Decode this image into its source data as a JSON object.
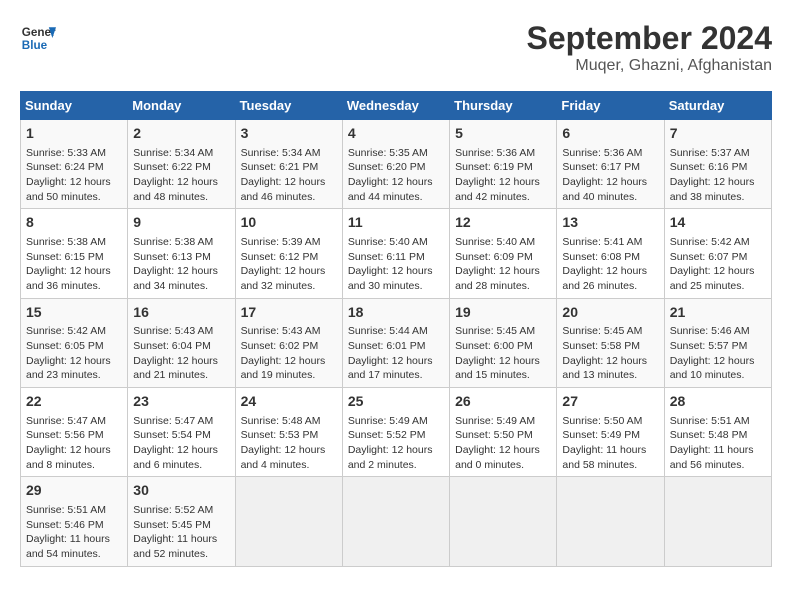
{
  "header": {
    "logo_line1": "General",
    "logo_line2": "Blue",
    "title": "September 2024",
    "subtitle": "Muqer, Ghazni, Afghanistan"
  },
  "columns": [
    "Sunday",
    "Monday",
    "Tuesday",
    "Wednesday",
    "Thursday",
    "Friday",
    "Saturday"
  ],
  "weeks": [
    [
      {
        "day": "1",
        "lines": [
          "Sunrise: 5:33 AM",
          "Sunset: 6:24 PM",
          "Daylight: 12 hours",
          "and 50 minutes."
        ]
      },
      {
        "day": "2",
        "lines": [
          "Sunrise: 5:34 AM",
          "Sunset: 6:22 PM",
          "Daylight: 12 hours",
          "and 48 minutes."
        ]
      },
      {
        "day": "3",
        "lines": [
          "Sunrise: 5:34 AM",
          "Sunset: 6:21 PM",
          "Daylight: 12 hours",
          "and 46 minutes."
        ]
      },
      {
        "day": "4",
        "lines": [
          "Sunrise: 5:35 AM",
          "Sunset: 6:20 PM",
          "Daylight: 12 hours",
          "and 44 minutes."
        ]
      },
      {
        "day": "5",
        "lines": [
          "Sunrise: 5:36 AM",
          "Sunset: 6:19 PM",
          "Daylight: 12 hours",
          "and 42 minutes."
        ]
      },
      {
        "day": "6",
        "lines": [
          "Sunrise: 5:36 AM",
          "Sunset: 6:17 PM",
          "Daylight: 12 hours",
          "and 40 minutes."
        ]
      },
      {
        "day": "7",
        "lines": [
          "Sunrise: 5:37 AM",
          "Sunset: 6:16 PM",
          "Daylight: 12 hours",
          "and 38 minutes."
        ]
      }
    ],
    [
      {
        "day": "8",
        "lines": [
          "Sunrise: 5:38 AM",
          "Sunset: 6:15 PM",
          "Daylight: 12 hours",
          "and 36 minutes."
        ]
      },
      {
        "day": "9",
        "lines": [
          "Sunrise: 5:38 AM",
          "Sunset: 6:13 PM",
          "Daylight: 12 hours",
          "and 34 minutes."
        ]
      },
      {
        "day": "10",
        "lines": [
          "Sunrise: 5:39 AM",
          "Sunset: 6:12 PM",
          "Daylight: 12 hours",
          "and 32 minutes."
        ]
      },
      {
        "day": "11",
        "lines": [
          "Sunrise: 5:40 AM",
          "Sunset: 6:11 PM",
          "Daylight: 12 hours",
          "and 30 minutes."
        ]
      },
      {
        "day": "12",
        "lines": [
          "Sunrise: 5:40 AM",
          "Sunset: 6:09 PM",
          "Daylight: 12 hours",
          "and 28 minutes."
        ]
      },
      {
        "day": "13",
        "lines": [
          "Sunrise: 5:41 AM",
          "Sunset: 6:08 PM",
          "Daylight: 12 hours",
          "and 26 minutes."
        ]
      },
      {
        "day": "14",
        "lines": [
          "Sunrise: 5:42 AM",
          "Sunset: 6:07 PM",
          "Daylight: 12 hours",
          "and 25 minutes."
        ]
      }
    ],
    [
      {
        "day": "15",
        "lines": [
          "Sunrise: 5:42 AM",
          "Sunset: 6:05 PM",
          "Daylight: 12 hours",
          "and 23 minutes."
        ]
      },
      {
        "day": "16",
        "lines": [
          "Sunrise: 5:43 AM",
          "Sunset: 6:04 PM",
          "Daylight: 12 hours",
          "and 21 minutes."
        ]
      },
      {
        "day": "17",
        "lines": [
          "Sunrise: 5:43 AM",
          "Sunset: 6:02 PM",
          "Daylight: 12 hours",
          "and 19 minutes."
        ]
      },
      {
        "day": "18",
        "lines": [
          "Sunrise: 5:44 AM",
          "Sunset: 6:01 PM",
          "Daylight: 12 hours",
          "and 17 minutes."
        ]
      },
      {
        "day": "19",
        "lines": [
          "Sunrise: 5:45 AM",
          "Sunset: 6:00 PM",
          "Daylight: 12 hours",
          "and 15 minutes."
        ]
      },
      {
        "day": "20",
        "lines": [
          "Sunrise: 5:45 AM",
          "Sunset: 5:58 PM",
          "Daylight: 12 hours",
          "and 13 minutes."
        ]
      },
      {
        "day": "21",
        "lines": [
          "Sunrise: 5:46 AM",
          "Sunset: 5:57 PM",
          "Daylight: 12 hours",
          "and 10 minutes."
        ]
      }
    ],
    [
      {
        "day": "22",
        "lines": [
          "Sunrise: 5:47 AM",
          "Sunset: 5:56 PM",
          "Daylight: 12 hours",
          "and 8 minutes."
        ]
      },
      {
        "day": "23",
        "lines": [
          "Sunrise: 5:47 AM",
          "Sunset: 5:54 PM",
          "Daylight: 12 hours",
          "and 6 minutes."
        ]
      },
      {
        "day": "24",
        "lines": [
          "Sunrise: 5:48 AM",
          "Sunset: 5:53 PM",
          "Daylight: 12 hours",
          "and 4 minutes."
        ]
      },
      {
        "day": "25",
        "lines": [
          "Sunrise: 5:49 AM",
          "Sunset: 5:52 PM",
          "Daylight: 12 hours",
          "and 2 minutes."
        ]
      },
      {
        "day": "26",
        "lines": [
          "Sunrise: 5:49 AM",
          "Sunset: 5:50 PM",
          "Daylight: 12 hours",
          "and 0 minutes."
        ]
      },
      {
        "day": "27",
        "lines": [
          "Sunrise: 5:50 AM",
          "Sunset: 5:49 PM",
          "Daylight: 11 hours",
          "and 58 minutes."
        ]
      },
      {
        "day": "28",
        "lines": [
          "Sunrise: 5:51 AM",
          "Sunset: 5:48 PM",
          "Daylight: 11 hours",
          "and 56 minutes."
        ]
      }
    ],
    [
      {
        "day": "29",
        "lines": [
          "Sunrise: 5:51 AM",
          "Sunset: 5:46 PM",
          "Daylight: 11 hours",
          "and 54 minutes."
        ]
      },
      {
        "day": "30",
        "lines": [
          "Sunrise: 5:52 AM",
          "Sunset: 5:45 PM",
          "Daylight: 11 hours",
          "and 52 minutes."
        ]
      },
      {
        "day": "",
        "lines": []
      },
      {
        "day": "",
        "lines": []
      },
      {
        "day": "",
        "lines": []
      },
      {
        "day": "",
        "lines": []
      },
      {
        "day": "",
        "lines": []
      }
    ]
  ]
}
